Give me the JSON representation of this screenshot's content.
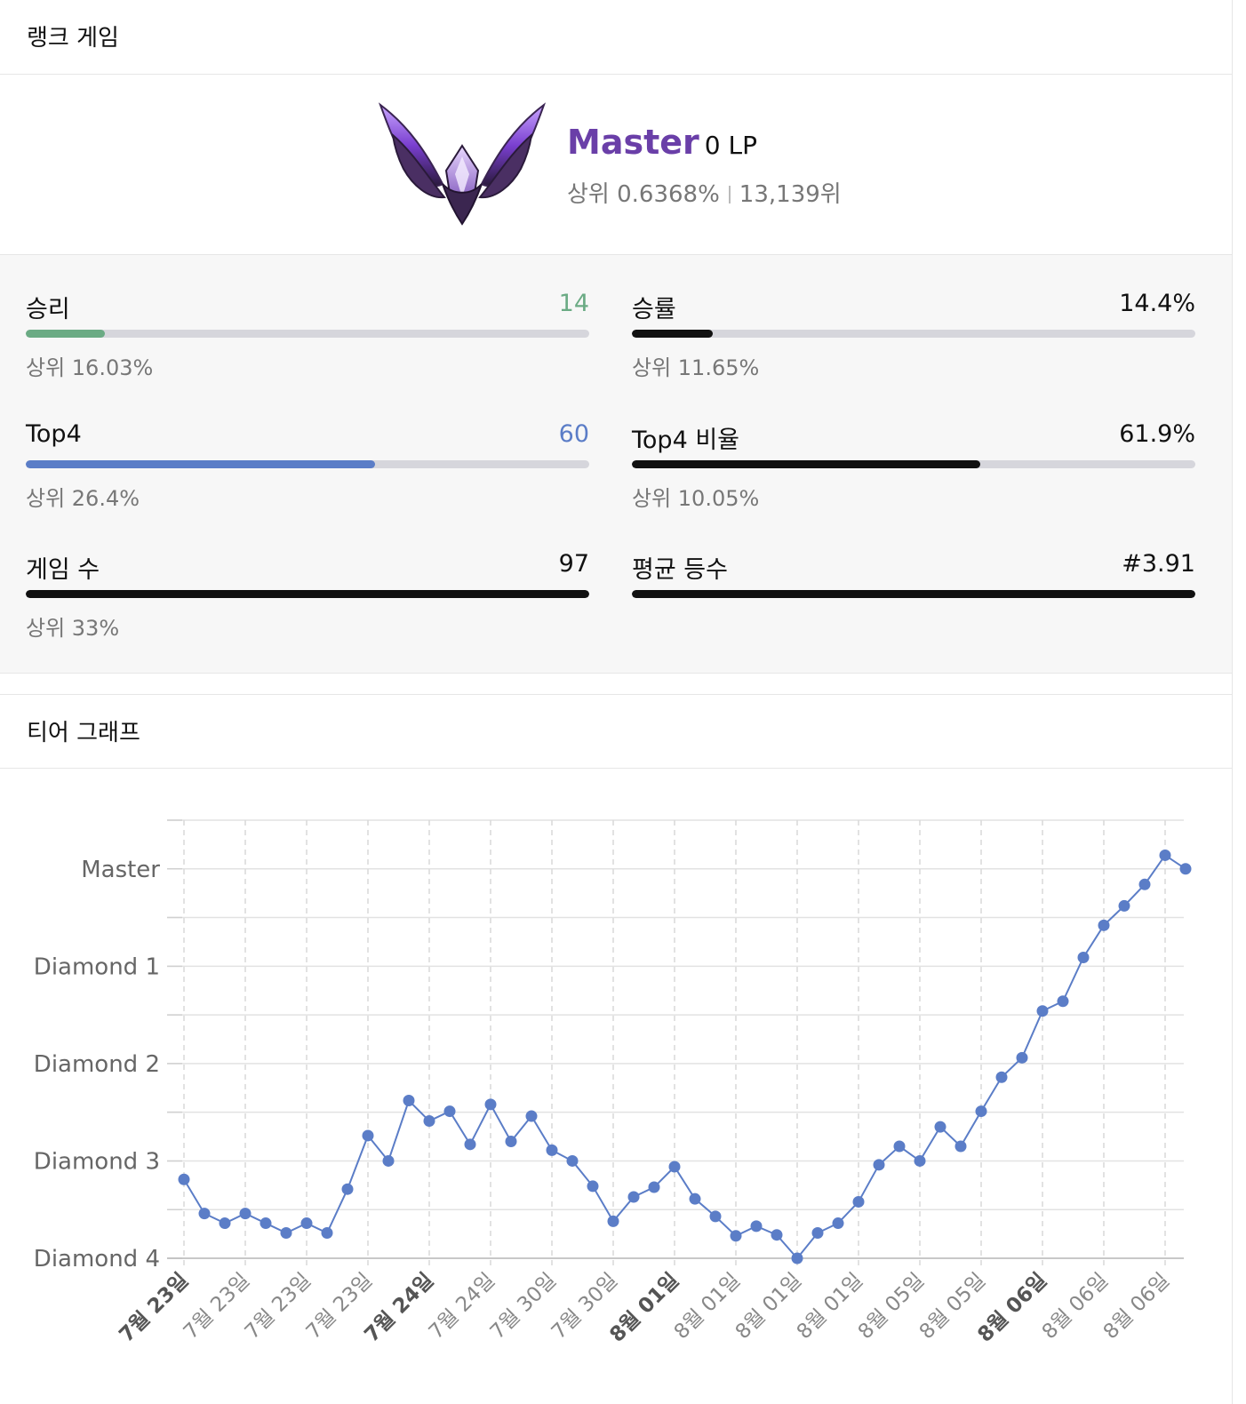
{
  "ranked": {
    "header": "랭크 게임",
    "tier_name": "Master",
    "lp": "0 LP",
    "top_percent": "상위 0.6368%",
    "rank": "13,139위"
  },
  "stats": {
    "left": [
      {
        "label": "승리",
        "value": "14",
        "fill": 0.14,
        "color": "#6bab84",
        "sub": "상위 16.03%"
      },
      {
        "label": "Top4",
        "value": "60",
        "fill": 0.62,
        "color": "#5b7dc7",
        "sub": "상위 26.4%"
      },
      {
        "label": "게임 수",
        "value": "97",
        "fill": 1.0,
        "color": "#111111",
        "sub": "상위 33%"
      }
    ],
    "right": [
      {
        "label": "승률",
        "value": "14.4%",
        "fill": 0.144,
        "color": "#111111",
        "sub": "상위 11.65%"
      },
      {
        "label": "Top4 비율",
        "value": "61.9%",
        "fill": 0.619,
        "color": "#111111",
        "sub": "상위 10.05%"
      },
      {
        "label": "평균 등수",
        "value": "#3.91",
        "fill": 1.0,
        "color": "#111111",
        "sub": ""
      }
    ],
    "value_colors": {
      "win": "#6bab84",
      "top4": "#5b7dc7"
    }
  },
  "graph": {
    "header": "티어 그래프"
  },
  "chart_data": {
    "type": "line",
    "title": "",
    "xlabel": "",
    "ylabel": "",
    "y_categories": [
      "Diamond 4",
      "Diamond 3",
      "Diamond 2",
      "Diamond 1",
      "Master"
    ],
    "ylim": [
      0,
      4.5
    ],
    "x_tick_labels": [
      {
        "label": "7월 23일",
        "bold": true
      },
      {
        "label": "7월 23일",
        "bold": false
      },
      {
        "label": "7월 23일",
        "bold": false
      },
      {
        "label": "7월 23일",
        "bold": false
      },
      {
        "label": "7월 24일",
        "bold": true
      },
      {
        "label": "7월 24일",
        "bold": false
      },
      {
        "label": "7월 30일",
        "bold": false
      },
      {
        "label": "7월 30일",
        "bold": false
      },
      {
        "label": "8월 01일",
        "bold": true
      },
      {
        "label": "8월 01일",
        "bold": false
      },
      {
        "label": "8월 01일",
        "bold": false
      },
      {
        "label": "8월 01일",
        "bold": false
      },
      {
        "label": "8월 05일",
        "bold": false
      },
      {
        "label": "8월 05일",
        "bold": false
      },
      {
        "label": "8월 06일",
        "bold": true
      },
      {
        "label": "8월 06일",
        "bold": false
      },
      {
        "label": "8월 06일",
        "bold": false
      }
    ],
    "series": [
      {
        "values": [
          0.81,
          0.46,
          0.36,
          0.46,
          0.36,
          0.26,
          0.36,
          0.26,
          0.71,
          1.26,
          1.0,
          1.62,
          1.41,
          1.51,
          1.17,
          1.58,
          1.2,
          1.46,
          1.11,
          1.0,
          0.74,
          0.38,
          0.63,
          0.73,
          0.94,
          0.61,
          0.43,
          0.23,
          0.33,
          0.24,
          0.0,
          0.26,
          0.36,
          0.58,
          0.96,
          1.15,
          1.0,
          1.35,
          1.15,
          1.51,
          1.86,
          2.06,
          2.54,
          2.64,
          3.09,
          3.42,
          3.62,
          3.84,
          4.14,
          4.0
        ],
        "color": "#5b7dc7"
      }
    ],
    "grid": true
  }
}
